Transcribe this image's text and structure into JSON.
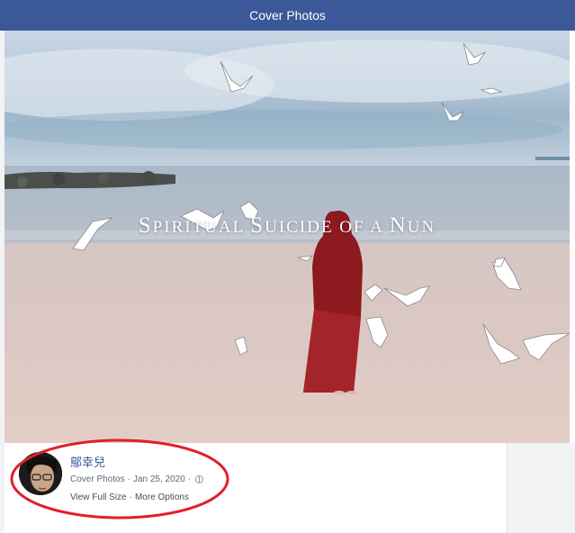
{
  "header": {
    "title": "Cover Photos"
  },
  "photo": {
    "overlay_caption_first": "S",
    "overlay_caption_rest_1": "piritual ",
    "overlay_caption_second": "S",
    "overlay_caption_rest_2": "uicide of a ",
    "overlay_caption_third": "N",
    "overlay_caption_rest_3": "un"
  },
  "post": {
    "author": "鄔幸兒",
    "album_link": "Cover Photos",
    "separator": "·",
    "date": "Jan 25, 2020",
    "privacy_icon": "globe-icon",
    "view_full_size": "View Full Size",
    "more_options": "More Options"
  },
  "colors": {
    "header_bg": "#3b5998",
    "link": "#365899",
    "highlight_ellipse": "#e0202a",
    "robe": "#8c1a1f"
  }
}
